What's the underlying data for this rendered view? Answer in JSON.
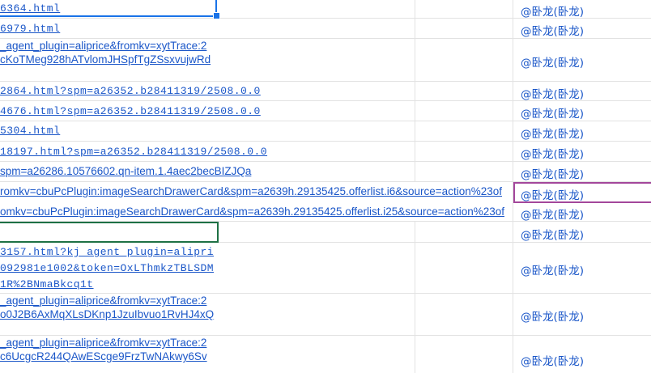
{
  "rows": [
    {
      "lines": [
        "6364.html"
      ],
      "font": "mono",
      "who": "@卧龙(卧龙)"
    },
    {
      "lines": [
        "6979.html"
      ],
      "font": "mono",
      "who": "@卧龙(卧龙)"
    },
    {
      "lines": [
        "_agent_plugin=aliprice&fromkv=xytTrace:2",
        "cKoTMeg928hATvlomJHSpfTgZSsxvujwRd"
      ],
      "font": "sans",
      "who": "@卧龙(卧龙)"
    },
    {
      "lines": [
        "2864.html?spm=a26352.b28411319/2508.0.0"
      ],
      "font": "mono",
      "who": "@卧龙(卧龙)"
    },
    {
      "lines": [
        "4676.html?spm=a26352.b28411319/2508.0.0"
      ],
      "font": "mono",
      "who": "@卧龙(卧龙)"
    },
    {
      "lines": [
        "5304.html"
      ],
      "font": "mono",
      "who": "@卧龙(卧龙)"
    },
    {
      "lines": [
        "18197.html?spm=a26352.b28411319/2508.0.0"
      ],
      "font": "mono",
      "who": "@卧龙(卧龙)"
    },
    {
      "lines": [
        "spm=a26286.10576602.qn-item.1.4aec2becBIZJQa"
      ],
      "font": "sans",
      "who": "@卧龙(卧龙)"
    },
    {
      "lines": [
        "romkv=cbuPcPlugin:imageSearchDrawerCard&spm=a2639h.29135425.offerlist.i6&source=action%23of"
      ],
      "font": "sans",
      "who": "@卧龙(卧龙)"
    },
    {
      "lines": [
        "omkv=cbuPcPlugin:imageSearchDrawerCard&spm=a2639h.29135425.offerlist.i25&source=action%23of"
      ],
      "font": "sans",
      "who": "@卧龙(卧龙)"
    },
    {
      "lines": [],
      "font": "sans",
      "who": "@卧龙(卧龙)"
    },
    {
      "lines": [
        "3157.html?kj_agent_plugin=alipri",
        "092981e1002&token=OxLThmkzTBLSDM",
        "1R%2BNmaBkcq1t"
      ],
      "font": "mono",
      "who": "@卧龙(卧龙)"
    },
    {
      "lines": [
        "_agent_plugin=aliprice&fromkv=xytTrace:2",
        "o0J2B6AxMqXLsDKnp1JzuIbvuo1RvHJ4xQ"
      ],
      "font": "sans",
      "who": "@卧龙(卧龙)"
    },
    {
      "lines": [
        "_agent_plugin=aliprice&fromkv=xytTrace:2",
        "c6UcgcR244QAwEScge9FrzTwNAkwy6Sv"
      ],
      "font": "sans",
      "who": "@卧龙(卧龙)"
    }
  ],
  "colors": {
    "link": "#1a56c8",
    "gridline": "#e2e2e2",
    "selection_blue": "#1a73e8",
    "selection_green": "#1e7145",
    "selection_purple": "#a3479b"
  }
}
